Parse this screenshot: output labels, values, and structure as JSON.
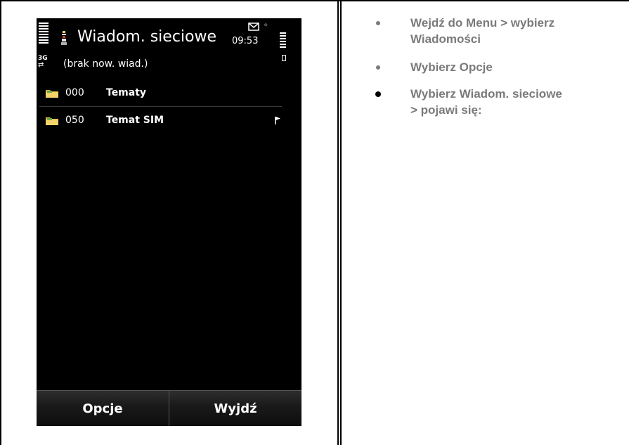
{
  "phone": {
    "title": "Wiadom. sieciowe",
    "clock": "09:53",
    "network": "3G",
    "subtitle": "(brak now. wiad.)",
    "topics": [
      {
        "number": "000",
        "name": "Tematy",
        "flagged": false
      },
      {
        "number": "050",
        "name": "Temat SIM",
        "flagged": true
      }
    ],
    "softkeys": {
      "left": "Opcje",
      "right": "Wyjdź"
    },
    "icons": [
      "signal-icon",
      "app-icon",
      "envelope-icon",
      "hold-icon",
      "battery-icon",
      "folder-icon",
      "flag-icon"
    ]
  },
  "instructions": [
    "Wejdź do Menu > wybierz\nWiadomości",
    "Wybierz Opcje",
    "Wybierz Wiadom. sieciowe\n> pojawi się:"
  ]
}
